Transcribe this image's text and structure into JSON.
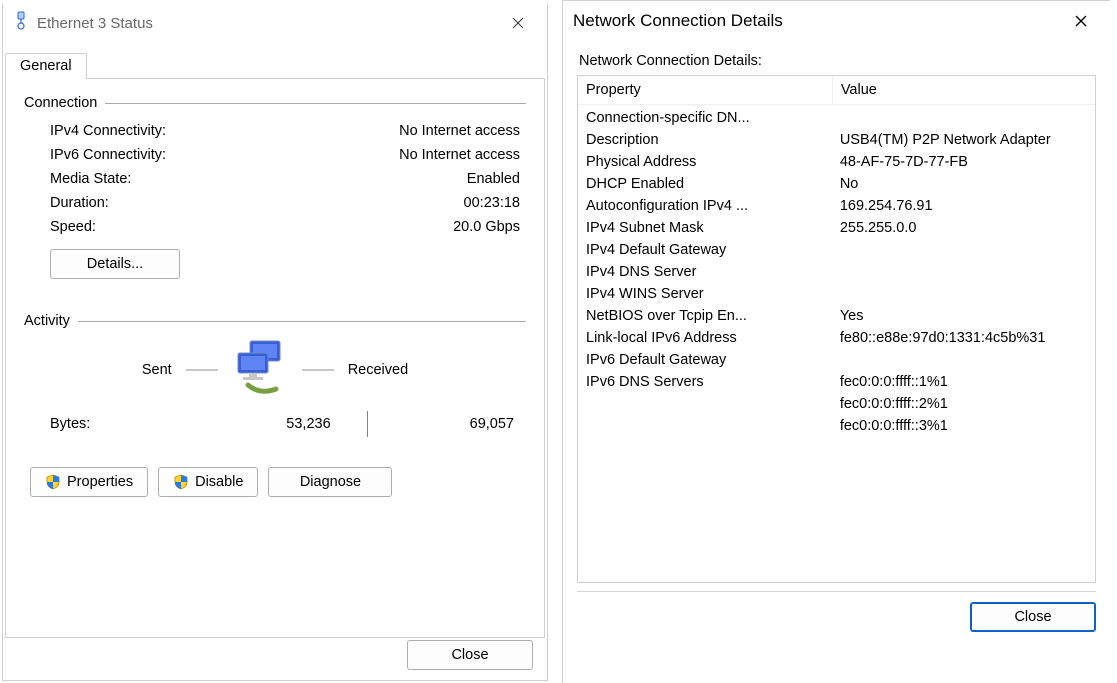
{
  "status": {
    "window_title": "Ethernet 3 Status",
    "tab_general": "General",
    "group_connection": "Connection",
    "ipv4_label": "IPv4 Connectivity:",
    "ipv4_value": "No Internet access",
    "ipv6_label": "IPv6 Connectivity:",
    "ipv6_value": "No Internet access",
    "media_label": "Media State:",
    "media_value": "Enabled",
    "duration_label": "Duration:",
    "duration_value": "00:23:18",
    "speed_label": "Speed:",
    "speed_value": "20.0 Gbps",
    "details_button": "Details...",
    "group_activity": "Activity",
    "sent_label": "Sent",
    "received_label": "Received",
    "bytes_label": "Bytes:",
    "bytes_sent": "53,236",
    "bytes_recv": "69,057",
    "properties_btn": "Properties",
    "disable_btn": "Disable",
    "diagnose_btn": "Diagnose",
    "close_btn": "Close"
  },
  "details": {
    "window_title": "Network Connection Details",
    "section_label": "Network Connection Details:",
    "col_property": "Property",
    "col_value": "Value",
    "rows": [
      {
        "prop": "Connection-specific DN...",
        "val": ""
      },
      {
        "prop": "Description",
        "val": "USB4(TM) P2P Network Adapter"
      },
      {
        "prop": "Physical Address",
        "val": "48-AF-75-7D-77-FB"
      },
      {
        "prop": "DHCP Enabled",
        "val": "No"
      },
      {
        "prop": "Autoconfiguration IPv4 ...",
        "val": "169.254.76.91"
      },
      {
        "prop": "IPv4 Subnet Mask",
        "val": "255.255.0.0"
      },
      {
        "prop": "IPv4 Default Gateway",
        "val": ""
      },
      {
        "prop": "IPv4 DNS Server",
        "val": ""
      },
      {
        "prop": "IPv4 WINS Server",
        "val": ""
      },
      {
        "prop": "NetBIOS over Tcpip En...",
        "val": "Yes"
      },
      {
        "prop": "Link-local IPv6 Address",
        "val": "fe80::e88e:97d0:1331:4c5b%31"
      },
      {
        "prop": "IPv6 Default Gateway",
        "val": ""
      },
      {
        "prop": "IPv6 DNS Servers",
        "val": "fec0:0:0:ffff::1%1"
      },
      {
        "prop": "",
        "val": "fec0:0:0:ffff::2%1"
      },
      {
        "prop": "",
        "val": "fec0:0:0:ffff::3%1"
      }
    ],
    "close_btn": "Close"
  }
}
